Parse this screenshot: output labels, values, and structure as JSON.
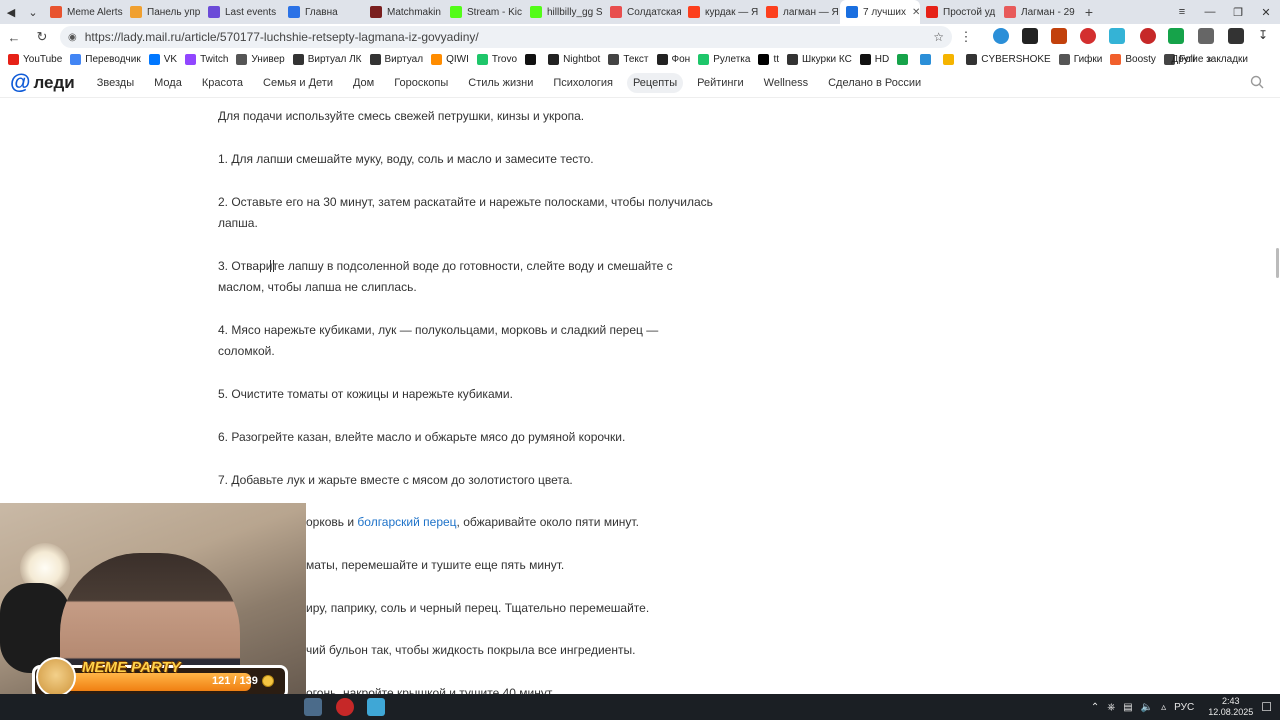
{
  "browser": {
    "tabs": [
      {
        "label": "Meme Alerts",
        "color": "#e8532f"
      },
      {
        "label": "Панель упр",
        "color": "#f0a030"
      },
      {
        "label": "Last events",
        "color": "#6b4bd8"
      },
      {
        "label": "Главна",
        "color": "#2b72e6",
        "muted": true
      },
      {
        "label": "Matchmakin",
        "color": "#7a1f1f"
      },
      {
        "label": "Stream - Kic",
        "color": "#53fc18"
      },
      {
        "label": "hillbilly_gg S",
        "color": "#53fc18"
      },
      {
        "label": "Солдатская",
        "color": "#e84e4e"
      },
      {
        "label": "курдак — Я",
        "color": "#fc3f1d"
      },
      {
        "label": "лагман — Я",
        "color": "#fc3f1d"
      },
      {
        "label": "7 лучших",
        "color": "#1a6fe0",
        "active": true
      },
      {
        "label": "Простой уд",
        "color": "#e62117"
      },
      {
        "label": "Лагман - 29",
        "color": "#e85a5a"
      }
    ],
    "url": "https://lady.mail.ru/article/570177-luchshie-retsepty-lagmana-iz-govyadiny/",
    "bookmarks": [
      {
        "label": "YouTube",
        "color": "#e62117"
      },
      {
        "label": "Переводчик",
        "color": "#4285f4"
      },
      {
        "label": "VK",
        "color": "#0077ff"
      },
      {
        "label": "Twitch",
        "color": "#9146ff"
      },
      {
        "label": "Универ",
        "color": "#555555"
      },
      {
        "label": "Виртуал ЛК",
        "color": "#333333"
      },
      {
        "label": "Виртуал",
        "color": "#333333"
      },
      {
        "label": "QIWI",
        "color": "#ff8c00"
      },
      {
        "label": "Trovo",
        "color": "#1ec66a"
      },
      {
        "label": "",
        "color": "#111111"
      },
      {
        "label": "Nightbot",
        "color": "#222222"
      },
      {
        "label": "Текст",
        "color": "#444444"
      },
      {
        "label": "Фон",
        "color": "#222222"
      },
      {
        "label": "Рулетка",
        "color": "#1ec66a"
      },
      {
        "label": "tt",
        "color": "#000000"
      },
      {
        "label": "Шкурки КС",
        "color": "#333333"
      },
      {
        "label": "HD",
        "color": "#111111"
      },
      {
        "label": "",
        "color": "#16a34a"
      },
      {
        "label": "",
        "color": "#2b8fd8"
      },
      {
        "label": "",
        "color": "#f5b400"
      },
      {
        "label": "CYBERSHOKE",
        "color": "#333333"
      },
      {
        "label": "Гифки",
        "color": "#555555"
      },
      {
        "label": "Boosty",
        "color": "#f15f2c"
      },
      {
        "label": "Foll",
        "color": "#444444"
      }
    ],
    "other_bookmarks": "Другие закладки"
  },
  "site": {
    "logo_text": "леди",
    "nav": [
      {
        "label": "Звезды"
      },
      {
        "label": "Мода"
      },
      {
        "label": "Красота"
      },
      {
        "label": "Семья и Дети"
      },
      {
        "label": "Дом"
      },
      {
        "label": "Гороскопы"
      },
      {
        "label": "Стиль жизни"
      },
      {
        "label": "Психология"
      },
      {
        "label": "Рецепты",
        "active": true
      },
      {
        "label": "Рейтинги"
      },
      {
        "label": "Wellness"
      },
      {
        "label": "Сделано в России"
      }
    ]
  },
  "article": {
    "paragraphs": [
      {
        "text": "Для подачи используйте смесь свежей петрушки, кинзы и укропа."
      },
      {
        "text": "1. Для лапши смешайте муку, воду, соль и масло и замесите тесто."
      },
      {
        "text": "2. Оставьте его на 30 минут, затем раскатайте и нарежьте полосками, чтобы получилась лапша."
      },
      {
        "text": "3. Отварите лапшу в подсоленной воде до готовности, слейте воду и смешайте с маслом, чтобы лапша не слиплась."
      },
      {
        "text": "4. Мясо нарежьте кубиками, лук — полукольцами, морковь и сладкий перец — соломкой."
      },
      {
        "text": "5. Очистите томаты от кожицы и нарежьте кубиками."
      },
      {
        "text": "6. Разогрейте казан, влейте масло и обжарьте мясо до румяной корочки."
      },
      {
        "text": "7. Добавьте лук и жарьте вместе с мясом до золотистого цвета."
      },
      {
        "text": "орковь и ",
        "link": "болгарский перец",
        "after": ", обжаривайте около пяти минут."
      },
      {
        "text": "маты, перемешайте и тушите еще пять минут."
      },
      {
        "text": "иру, паприку, соль и черный перец. Тщательно перемешайте."
      },
      {
        "text": "чий бульон так, чтобы жидкость покрыла все ингредиенты."
      },
      {
        "text": "огонь, накройте крышкой и тушите 40 минут."
      }
    ]
  },
  "overlay": {
    "title": "MEME PARTY",
    "count": "121 / 139",
    "progress": 0.87
  },
  "taskbar": {
    "lang": "РУС",
    "time": "2:43",
    "date": "12.08.2025"
  }
}
